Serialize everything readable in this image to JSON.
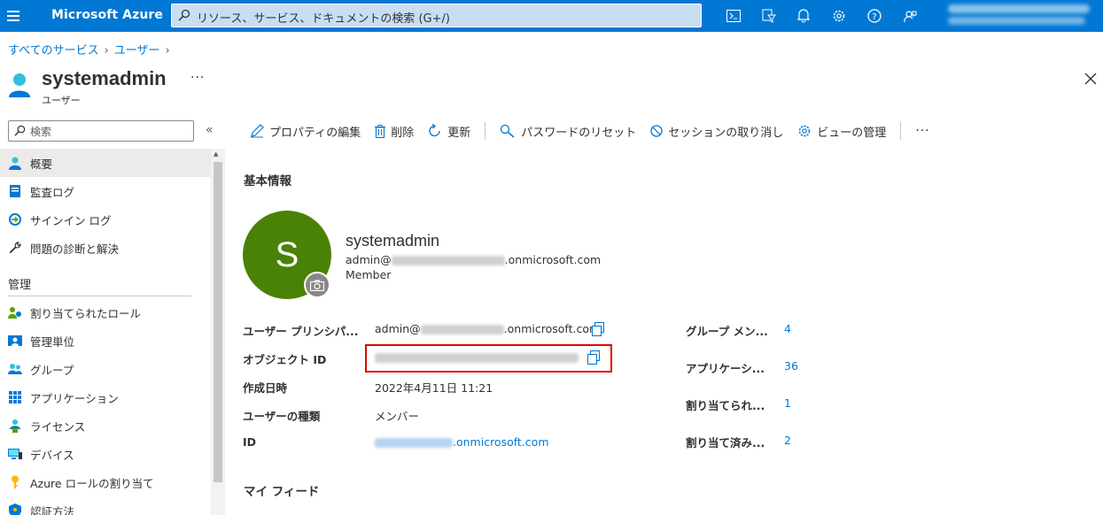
{
  "topbar": {
    "brand": "Microsoft Azure",
    "search_placeholder": "リソース、サービス、ドキュメントの検索 (G+/)",
    "icons": [
      "cloud-shell-icon",
      "directory-filter-icon",
      "notifications-icon",
      "settings-icon",
      "help-icon",
      "feedback-icon"
    ],
    "account_email": "admin@sugimomoto...",
    "account_tenant": "..."
  },
  "breadcrumb": [
    "すべてのサービス",
    "ユーザー"
  ],
  "header": {
    "title": "systemadmin",
    "subtitle": "ユーザー",
    "more": "···"
  },
  "sidebar": {
    "search_placeholder": "検索",
    "collapse": "«",
    "items_top": [
      {
        "label": "概要",
        "icon": "user-icon",
        "active": true
      },
      {
        "label": "監査ログ",
        "icon": "audit-log-icon"
      },
      {
        "label": "サインイン ログ",
        "icon": "signin-log-icon"
      },
      {
        "label": "問題の診断と解決",
        "icon": "wrench-icon"
      }
    ],
    "section_manage": "管理",
    "items_manage": [
      {
        "label": "割り当てられたロール",
        "icon": "roles-icon"
      },
      {
        "label": "管理単位",
        "icon": "admin-units-icon"
      },
      {
        "label": "グループ",
        "icon": "groups-icon"
      },
      {
        "label": "アプリケーション",
        "icon": "apps-icon"
      },
      {
        "label": "ライセンス",
        "icon": "license-icon"
      },
      {
        "label": "デバイス",
        "icon": "device-icon"
      },
      {
        "label": "Azure ロールの割り当て",
        "icon": "key-icon"
      },
      {
        "label": "認証方法",
        "icon": "shield-icon"
      }
    ]
  },
  "toolbar": {
    "edit": "プロパティの編集",
    "delete": "削除",
    "refresh": "更新",
    "reset_password": "パスワードのリセット",
    "revoke_sessions": "セッションの取り消し",
    "manage_view": "ビューの管理",
    "more": "···"
  },
  "basic_info": {
    "title": "基本情報",
    "avatar_letter": "S",
    "display_name": "systemadmin",
    "email_prefix": "admin@",
    "email_domain": ".onmicrosoft.com",
    "user_type": "Member"
  },
  "properties": {
    "upn_label": "ユーザー プリンシパ...",
    "upn_prefix": "admin@",
    "upn_domain": ".onmicrosoft.com",
    "object_id_label": "オブジェクト ID",
    "created_label": "作成日時",
    "created_value": "2022年4月11日 11:21",
    "usertype_label": "ユーザーの種類",
    "usertype_value": "メンバー",
    "id_label": "ID",
    "id_domain": ".onmicrosoft.com"
  },
  "counts": {
    "groups_label": "グループ メン...",
    "groups_value": "4",
    "apps_label": "アプリケーシ...",
    "apps_value": "36",
    "roles_label": "割り当てられ...",
    "roles_value": "1",
    "licenses_label": "割り当て済み...",
    "licenses_value": "2"
  },
  "feed": {
    "title": "マイ フィード"
  }
}
